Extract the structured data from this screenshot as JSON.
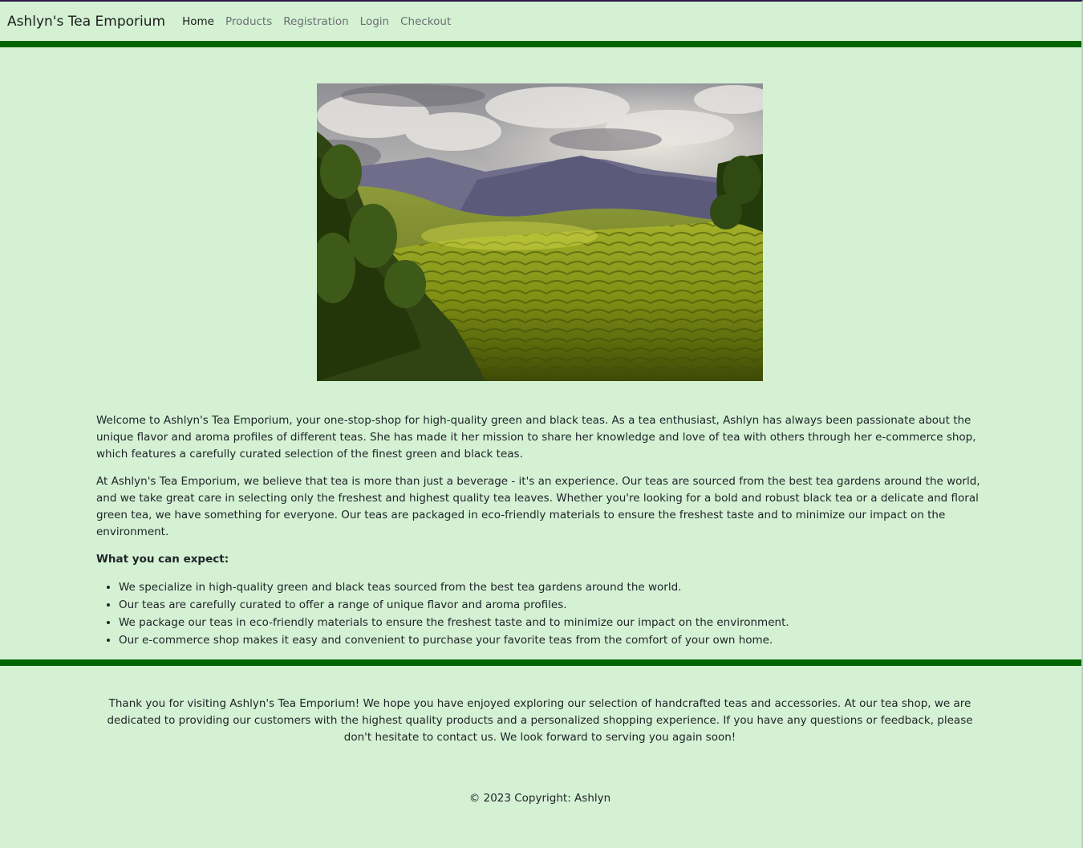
{
  "navbar": {
    "brand": "Ashlyn's Tea Emporium",
    "links": [
      {
        "label": "Home",
        "active": true
      },
      {
        "label": "Products",
        "active": false
      },
      {
        "label": "Registration",
        "active": false
      },
      {
        "label": "Login",
        "active": false
      },
      {
        "label": "Checkout",
        "active": false
      }
    ]
  },
  "hero": {
    "subject": "tea plantation landscape with mountains and cloudy sky"
  },
  "main": {
    "paragraph1": "Welcome to Ashlyn's Tea Emporium, your one-stop-shop for high-quality green and black teas. As a tea enthusiast, Ashlyn has always been passionate about the unique flavor and aroma profiles of different teas. She has made it her mission to share her knowledge and love of tea with others through her e-commerce shop, which features a carefully curated selection of the finest green and black teas.",
    "paragraph2": "At Ashlyn's Tea Emporium, we believe that tea is more than just a beverage - it's an experience. Our teas are sourced from the best tea gardens around the world, and we take great care in selecting only the freshest and highest quality tea leaves. Whether you're looking for a bold and robust black tea or a delicate and floral green tea, we have something for everyone. Our teas are packaged in eco-friendly materials to ensure the freshest taste and to minimize our impact on the environment.",
    "expect_heading": "What you can expect:",
    "expect_items": [
      "We specialize in high-quality green and black teas sourced from the best tea gardens around the world.",
      "Our teas are carefully curated to offer a range of unique flavor and aroma profiles.",
      "We package our teas in eco-friendly materials to ensure the freshest taste and to minimize our impact on the environment.",
      "Our e-commerce shop makes it easy and convenient to purchase your favorite teas from the comfort of your own home."
    ]
  },
  "footer": {
    "message": "Thank you for visiting Ashlyn's Tea Emporium! We hope you have enjoyed exploring our selection of handcrafted teas and accessories. At our tea shop, we are dedicated to providing our customers with the highest quality products and a personalized shopping experience. If you have any questions or feedback, please don't hesitate to contact us. We look forward to serving you again soon!",
    "copyright": "© 2023 Copyright: Ashlyn"
  },
  "colors": {
    "background": "#d4f1d4",
    "rule": "#006400",
    "text": "#212529"
  }
}
